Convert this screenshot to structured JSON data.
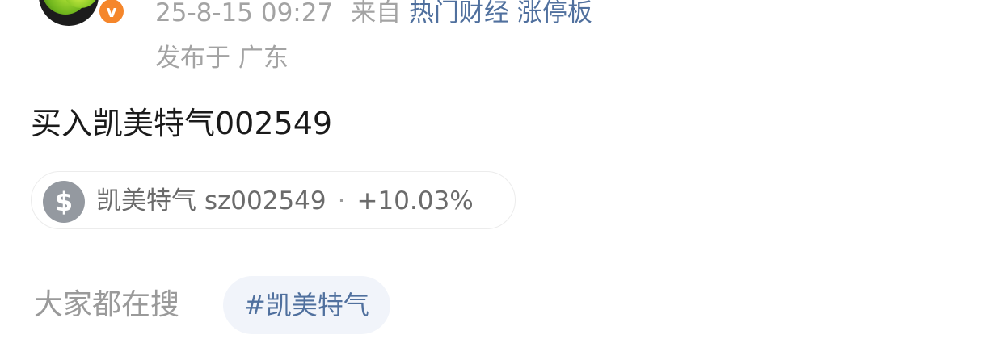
{
  "post": {
    "time": "25-8-15 09:27",
    "from_label": "来自",
    "source_links": [
      "热门财经",
      "涨停板"
    ],
    "location": "发布于 广东",
    "text": "买入凯美特气002549",
    "verified_badge": "v"
  },
  "stock": {
    "name": "凯美特气",
    "code": "sz002549",
    "separator": "·",
    "change": "+10.03%",
    "icon": "dollar-icon"
  },
  "trending": {
    "label": "大家都在搜",
    "topic": "#凯美特气"
  },
  "colors": {
    "link": "#50709e",
    "meta_gray": "#a3a3a3",
    "badge_orange": "#f5862b",
    "chip_bg": "#f1f4fa"
  }
}
